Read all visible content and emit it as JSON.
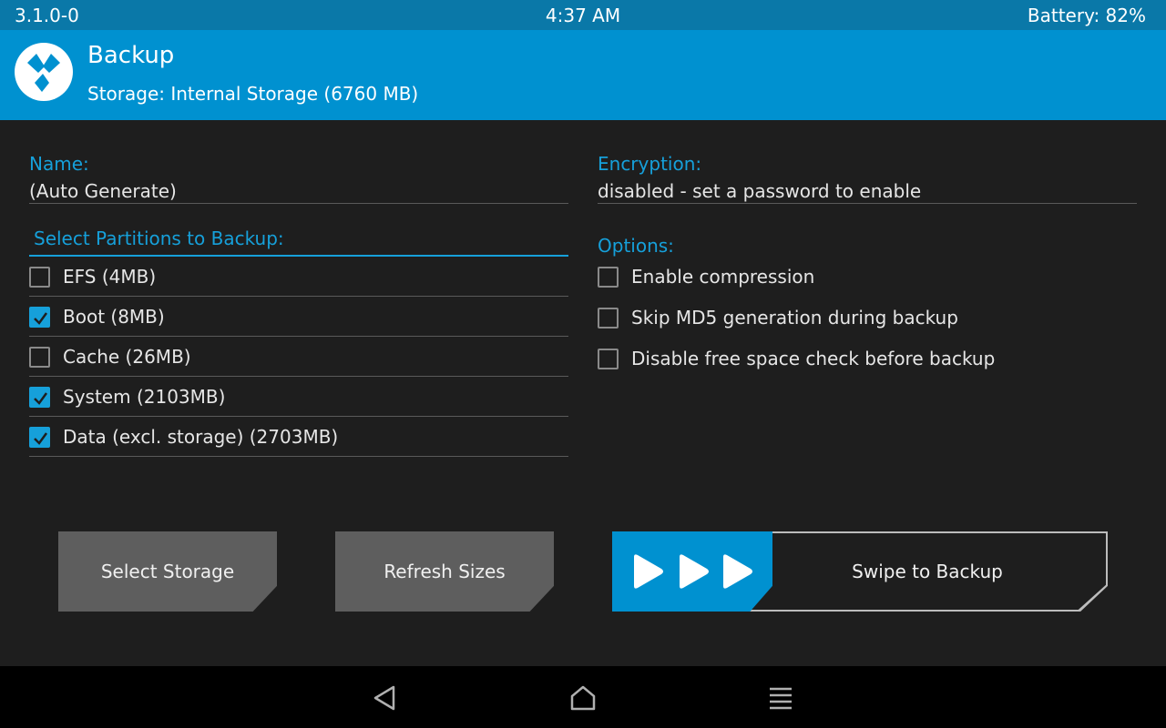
{
  "statusbar": {
    "version": "3.1.0-0",
    "time": "4:37 AM",
    "battery": "Battery: 82%"
  },
  "header": {
    "title": "Backup",
    "subtitle": "Storage: Internal Storage (6760 MB)",
    "logo_icon": "twrp-logo-icon"
  },
  "name_field": {
    "label": "Name:",
    "value": "(Auto Generate)"
  },
  "encryption_field": {
    "label": "Encryption:",
    "value": "disabled - set a password to enable"
  },
  "partitions": {
    "label": "Select Partitions to Backup:",
    "items": [
      {
        "label": "EFS (4MB)",
        "checked": false
      },
      {
        "label": "Boot (8MB)",
        "checked": true
      },
      {
        "label": "Cache (26MB)",
        "checked": false
      },
      {
        "label": "System (2103MB)",
        "checked": true
      },
      {
        "label": "Data (excl. storage) (2703MB)",
        "checked": true
      }
    ]
  },
  "options": {
    "label": "Options:",
    "items": [
      {
        "label": "Enable compression",
        "checked": false
      },
      {
        "label": "Skip MD5 generation during backup",
        "checked": false
      },
      {
        "label": "Disable free space check before backup",
        "checked": false
      }
    ]
  },
  "buttons": {
    "select_storage": "Select Storage",
    "refresh_sizes": "Refresh Sizes"
  },
  "swipe": {
    "label": "Swipe to Backup",
    "icon": "triple-play-arrows-icon"
  },
  "navbar": {
    "back_icon": "back-triangle-icon",
    "home_icon": "home-icon",
    "menu_icon": "menu-lines-icon"
  },
  "colors": {
    "accent": "#0091d0",
    "statusbar": "#0a78a8",
    "label_blue": "#16a0da",
    "background": "#1e1e1e",
    "button": "#5e5e5e"
  }
}
